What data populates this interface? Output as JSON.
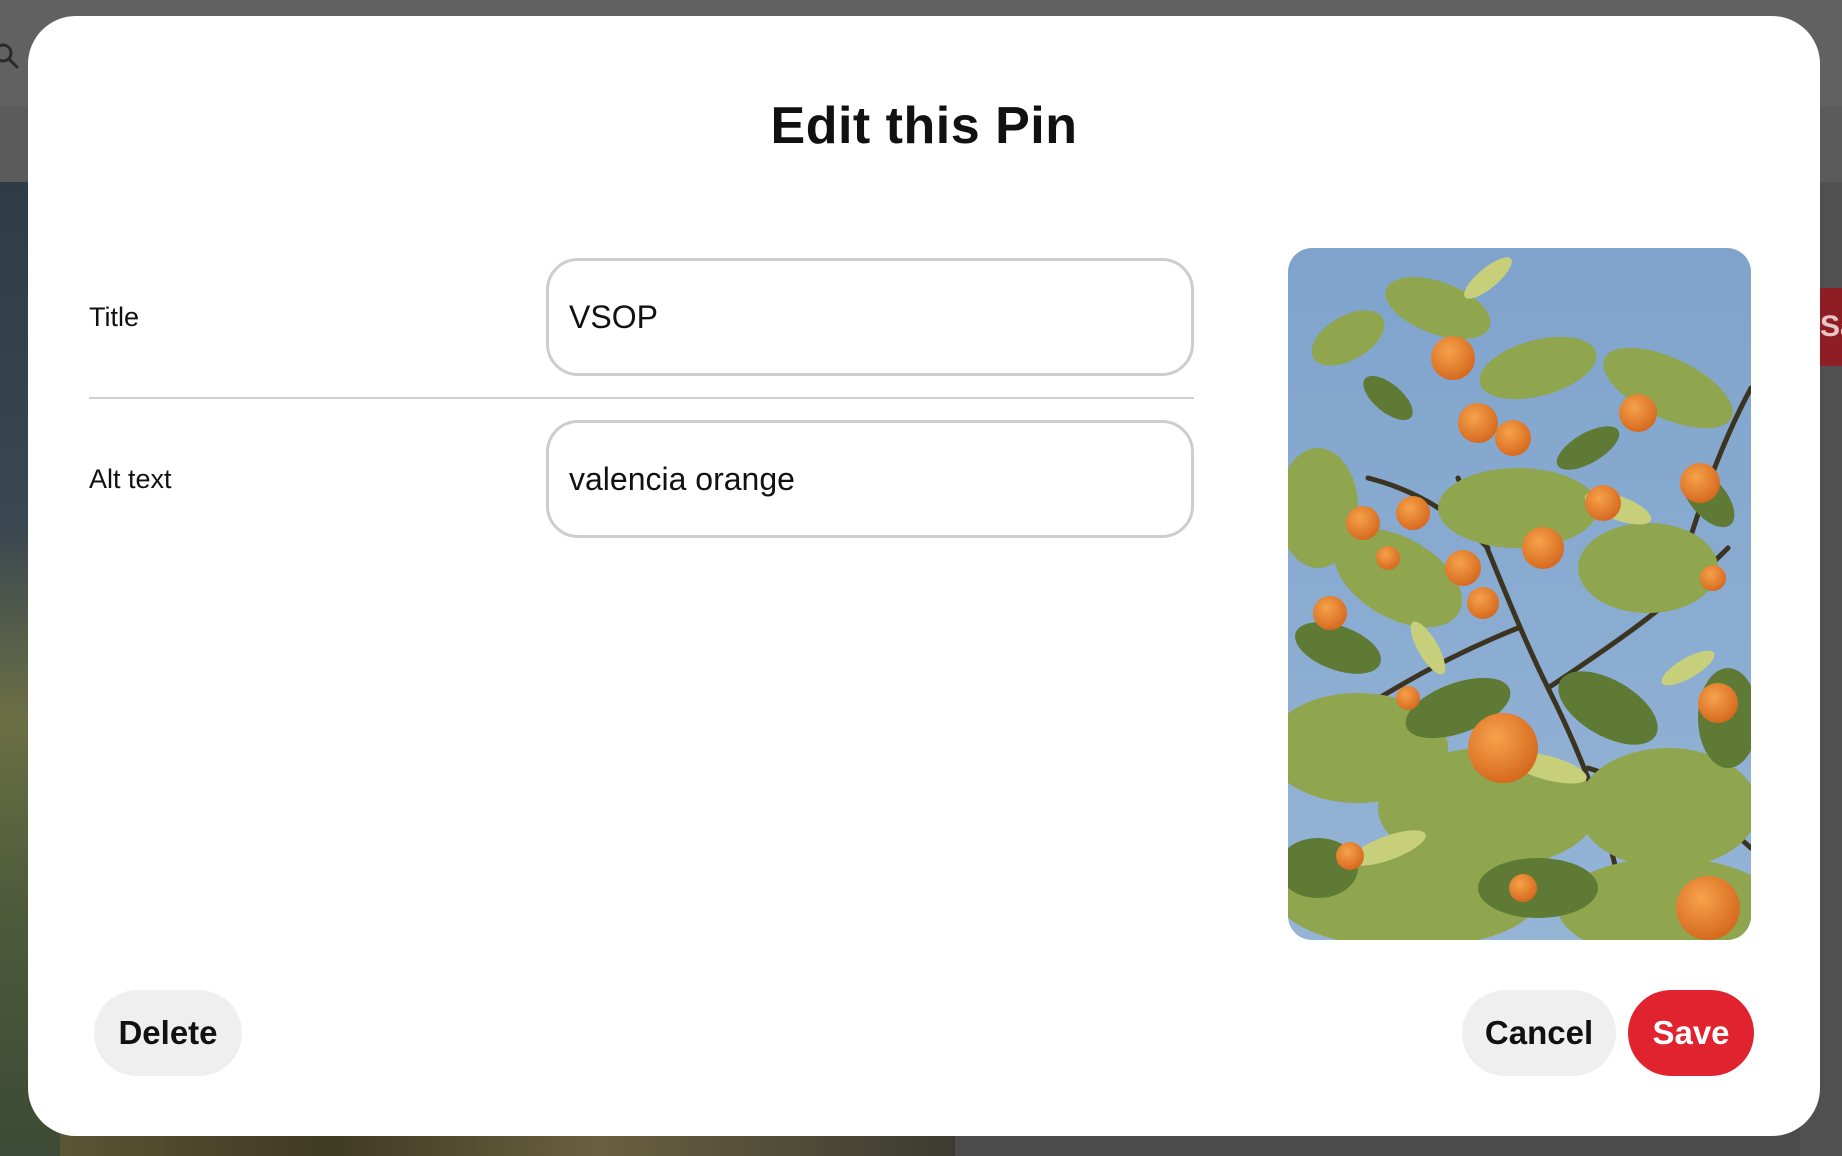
{
  "modal": {
    "title": "Edit this Pin"
  },
  "form": {
    "title_label": "Title",
    "title_value": "VSOP",
    "alt_label": "Alt text",
    "alt_value": "valencia orange"
  },
  "pin_image": {
    "description_icon": "orange-tree-image"
  },
  "buttons": {
    "delete_label": "Delete",
    "cancel_label": "Cancel",
    "save_label": "Save"
  },
  "background": {
    "save_peek_label": "Sa"
  },
  "colors": {
    "primary_red": "#e0232f",
    "secondary_gray": "#efefef",
    "overlay": "#4a4a4a"
  }
}
